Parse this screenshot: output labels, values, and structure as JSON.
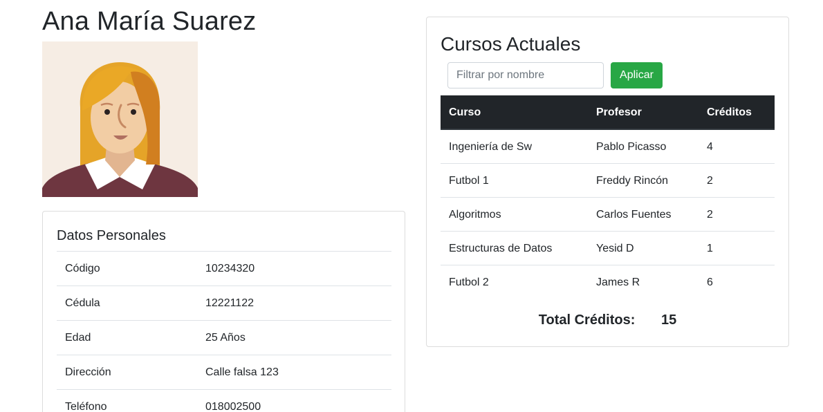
{
  "student": {
    "name": "Ana María Suarez"
  },
  "personal": {
    "title": "Datos Personales",
    "rows": [
      {
        "label": "Código",
        "value": "10234320"
      },
      {
        "label": "Cédula",
        "value": "12221122"
      },
      {
        "label": "Edad",
        "value": "25 Años"
      },
      {
        "label": "Dirección",
        "value": "Calle falsa 123"
      },
      {
        "label": "Teléfono",
        "value": "018002500"
      }
    ]
  },
  "courses": {
    "title": "Cursos Actuales",
    "filter_placeholder": "Filtrar por nombre",
    "filter_value": "",
    "apply_label": "Aplicar",
    "headers": {
      "course": "Curso",
      "professor": "Profesor",
      "credits": "Créditos"
    },
    "rows": [
      {
        "course": "Ingeniería de Sw",
        "professor": "Pablo Picasso",
        "credits": "4"
      },
      {
        "course": "Futbol 1",
        "professor": "Freddy Rincón",
        "credits": "2"
      },
      {
        "course": "Algoritmos",
        "professor": "Carlos Fuentes",
        "credits": "2"
      },
      {
        "course": "Estructuras de Datos",
        "professor": "Yesid D",
        "credits": "1"
      },
      {
        "course": "Futbol 2",
        "professor": "James R",
        "credits": "6"
      }
    ],
    "total_label": "Total Créditos:",
    "total_value": "15"
  },
  "colors": {
    "apply_button": "#28a745",
    "table_header": "#212529",
    "avatar_background": "#f6ede4"
  },
  "icons": {
    "avatar": "female-avatar-illustration"
  }
}
